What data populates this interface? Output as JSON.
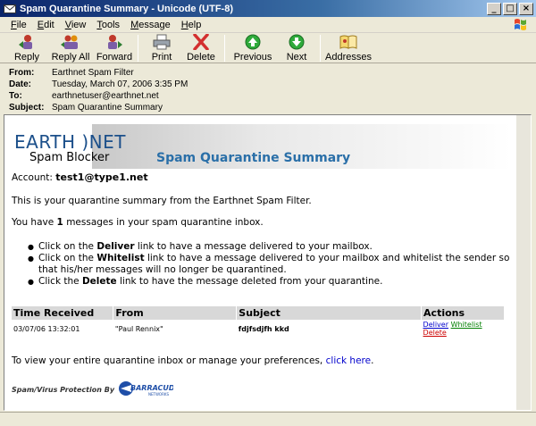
{
  "window": {
    "title": "Spam Quarantine Summary - Unicode (UTF-8)",
    "controls": {
      "minimize": "_",
      "maximize": "□",
      "close": "×"
    }
  },
  "menu": [
    {
      "key": "F",
      "rest": "ile"
    },
    {
      "key": "E",
      "rest": "dit"
    },
    {
      "key": "V",
      "rest": "iew"
    },
    {
      "key": "T",
      "rest": "ools"
    },
    {
      "key": "M",
      "rest": "essage"
    },
    {
      "key": "H",
      "rest": "elp"
    }
  ],
  "toolbar": {
    "reply": "Reply",
    "reply_all": "Reply All",
    "forward": "Forward",
    "print": "Print",
    "delete": "Delete",
    "previous": "Previous",
    "next": "Next",
    "addresses": "Addresses"
  },
  "headers": {
    "from_label": "From:",
    "from": "Earthnet Spam Filter",
    "date_label": "Date:",
    "date": "Tuesday, March 07, 2006 3:35 PM",
    "to_label": "To:",
    "to": "earthnetuser@earthnet.net",
    "subject_label": "Subject:",
    "subject": "Spam Quarantine Summary"
  },
  "body": {
    "logo_earth": "EARTH )NET",
    "logo_blocker": "Spam Blocker",
    "banner_title": "Spam Quarantine Summary",
    "account_label": "Account:",
    "account": "test1@type1.net",
    "intro": "This is your quarantine summary from the Earthnet Spam Filter.",
    "count_pre": "You have",
    "count_num": "1",
    "count_post": "messages in your spam quarantine inbox.",
    "bullets": [
      {
        "pre": "Click on the",
        "word": "Deliver",
        "post": "link to have a message delivered to your mailbox."
      },
      {
        "pre": "Click on the",
        "word": "Whitelist",
        "post": "link to have a message delivered to your mailbox and whitelist the sender so that his/her messages will no longer be quarantined."
      },
      {
        "pre": "Click the",
        "word": "Delete",
        "post": "link to have the message deleted from your quarantine."
      }
    ],
    "table": {
      "headers": [
        "Time Received",
        "From",
        "Subject",
        "Actions"
      ],
      "row": {
        "time": "03/07/06 13:32:01",
        "from": "\"Paul Rennix\"",
        "subject": "fdjfsdjfh kkd",
        "deliver": "Deliver",
        "whitelist": "Whitelist",
        "delete": "Delete"
      }
    },
    "footer_pre": "To view your entire quarantine inbox or manage your preferences,",
    "footer_link": "click here",
    "footer_post": ".",
    "powered_by": "Spam/Virus Protection By",
    "barracuda": "BARRACUDA",
    "barracuda_sub": "NETWORKS"
  },
  "colors": {
    "title_bar": "#0a246a",
    "banner_title": "#2a6fa8",
    "link": "#0000cc",
    "whitelist": "#008000",
    "delete": "#cc0000"
  }
}
